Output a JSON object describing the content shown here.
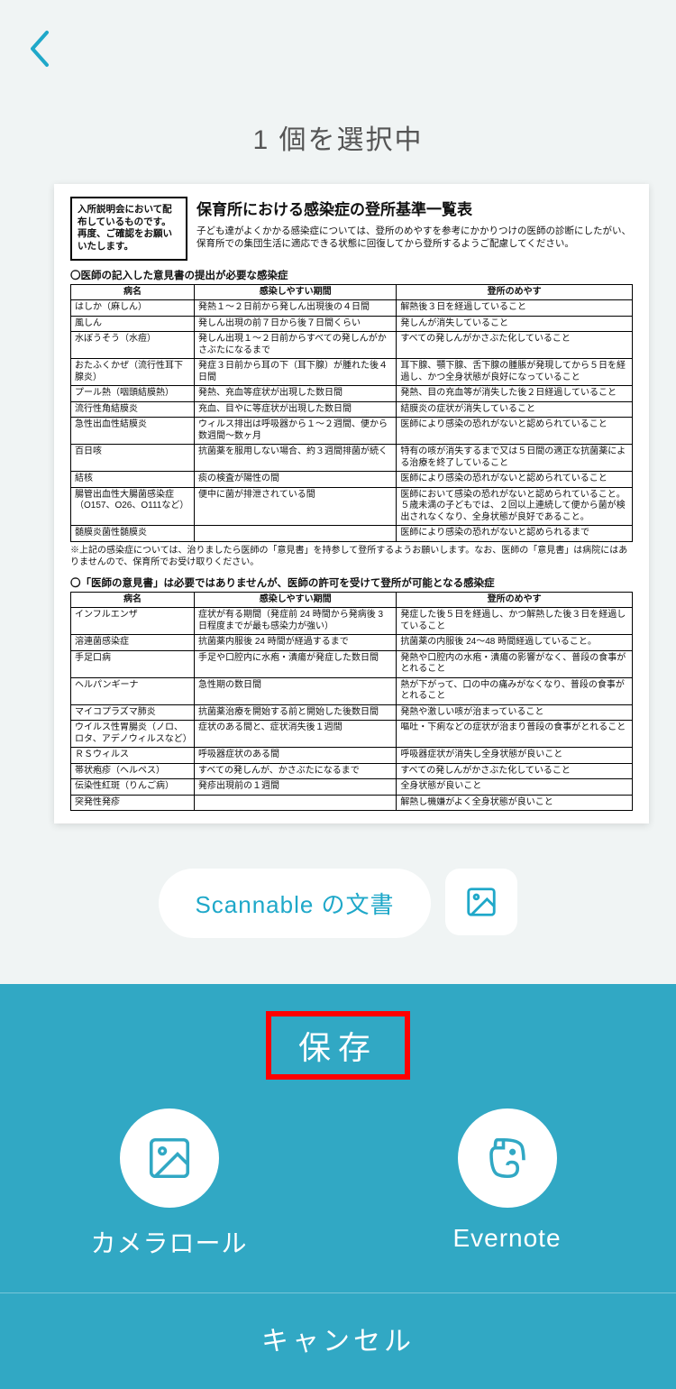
{
  "header": {
    "title": "1 個を選択中"
  },
  "filename": {
    "label": "Scannable の文書"
  },
  "save": {
    "header": "保存",
    "options": [
      {
        "label": "カメラロール"
      },
      {
        "label": "Evernote"
      }
    ],
    "cancel": "キャンセル"
  },
  "document": {
    "notice_box": "入所説明会において配布しているものです。再度、ご確認をお願いいたします。",
    "title": "保育所における感染症の登所基準一覧表",
    "intro": "子ども達がよくかかる感染症については、登所のめやすを参考にかかりつけの医師の診断にしたがい、保育所での集団生活に適応できる状態に回復してから登所するようご配慮してください。",
    "section1": {
      "heading": "〇医師の記入した意見書の提出が必要な感染症",
      "headers": [
        "病名",
        "感染しやすい期間",
        "登所のめやす"
      ],
      "rows": [
        [
          "はしか（麻しん）",
          "発熱１～２日前から発しん出現後の４日間",
          "解熱後３日を経過していること"
        ],
        [
          "風しん",
          "発しん出現の前７日から後７日間くらい",
          "発しんが消失していること"
        ],
        [
          "水ぼうそう（水痘）",
          "発しん出現１～２日前からすべての発しんがかさぶたになるまで",
          "すべての発しんがかさぶた化していること"
        ],
        [
          "おたふくかぜ（流行性耳下腺炎）",
          "発症３日前から耳の下（耳下腺）が腫れた後４日間",
          "耳下腺、顎下腺、舌下腺の腫脹が発現してから５日を経過し、かつ全身状態が良好になっていること"
        ],
        [
          "プール熱（咽頭結膜熱）",
          "発熱、充血等症状が出現した数日間",
          "発熱、目の充血等が消失した後２日経過していること"
        ],
        [
          "流行性角結膜炎",
          "充血、目やに等症状が出現した数日間",
          "結膜炎の症状が消失していること"
        ],
        [
          "急性出血性結膜炎",
          "ウィルス排出は呼吸器から１～２週間、便から数週間～数ヶ月",
          "医師により感染の恐れがないと認められていること"
        ],
        [
          "百日咳",
          "抗菌薬を服用しない場合、約３週間排菌が続く",
          "特有の咳が消失するまで又は５日間の適正な抗菌薬による治療を終了していること"
        ],
        [
          "結核",
          "痰の検査が陽性の間",
          "医師により感染の恐れがないと認められていること"
        ],
        [
          "腸管出血性大腸菌感染症（O157、O26、O111など）",
          "便中に菌が排泄されている間",
          "医師において感染の恐れがないと認められていること。５歳未満の子どもでは、２回以上連続して便から菌が検出されなくなり、全身状態が良好であること。"
        ],
        [
          "髄膜炎菌性髄膜炎",
          "",
          "医師により感染の恐れがないと認められるまで"
        ]
      ],
      "footnote": "※上記の感染症については、治りましたら医師の「意見書」を持参して登所するようお願いします。なお、医師の「意見書」は病院にはありませんので、保育所でお受け取りください。"
    },
    "section2": {
      "heading": "〇「医師の意見書」は必要ではありませんが、医師の許可を受けて登所が可能となる感染症",
      "headers": [
        "病名",
        "感染しやすい期間",
        "登所のめやす"
      ],
      "rows": [
        [
          "インフルエンザ",
          "症状が有る期間（発症前 24 時間から発病後 3 日程度までが最も感染力が強い）",
          "発症した後５日を経過し、かつ解熱した後３日を経過していること"
        ],
        [
          "溶連菌感染症",
          "抗菌薬内服後 24 時間が経過するまで",
          "抗菌薬の内服後 24～48 時間経過していること。"
        ],
        [
          "手足口病",
          "手足や口腔内に水疱・潰瘍が発症した数日間",
          "発熱や口腔内の水疱・潰瘍の影響がなく、普段の食事がとれること"
        ],
        [
          "ヘルパンギーナ",
          "急性期の数日間",
          "熱が下がって、口の中の痛みがなくなり、普段の食事がとれること"
        ],
        [
          "マイコプラズマ肺炎",
          "抗菌薬治療を開始する前と開始した後数日間",
          "発熱や激しい咳が治まっていること"
        ],
        [
          "ウイルス性胃腸炎（ノロ、ロタ、アデノウィルスなど）",
          "症状のある間と、症状消失後１週間",
          "嘔吐・下痢などの症状が治まり普段の食事がとれること"
        ],
        [
          "ＲＳウィルス",
          "呼吸器症状のある間",
          "呼吸器症状が消失し全身状態が良いこと"
        ],
        [
          "帯状疱疹（ヘルペス）",
          "すべての発しんが、かさぶたになるまで",
          "すべての発しんがかさぶた化していること"
        ],
        [
          "伝染性紅斑（りんご病）",
          "発疹出現前の１週間",
          "全身状態が良いこと"
        ],
        [
          "突発性発疹",
          "",
          "解熱し機嫌がよく全身状態が良いこと"
        ]
      ]
    }
  }
}
